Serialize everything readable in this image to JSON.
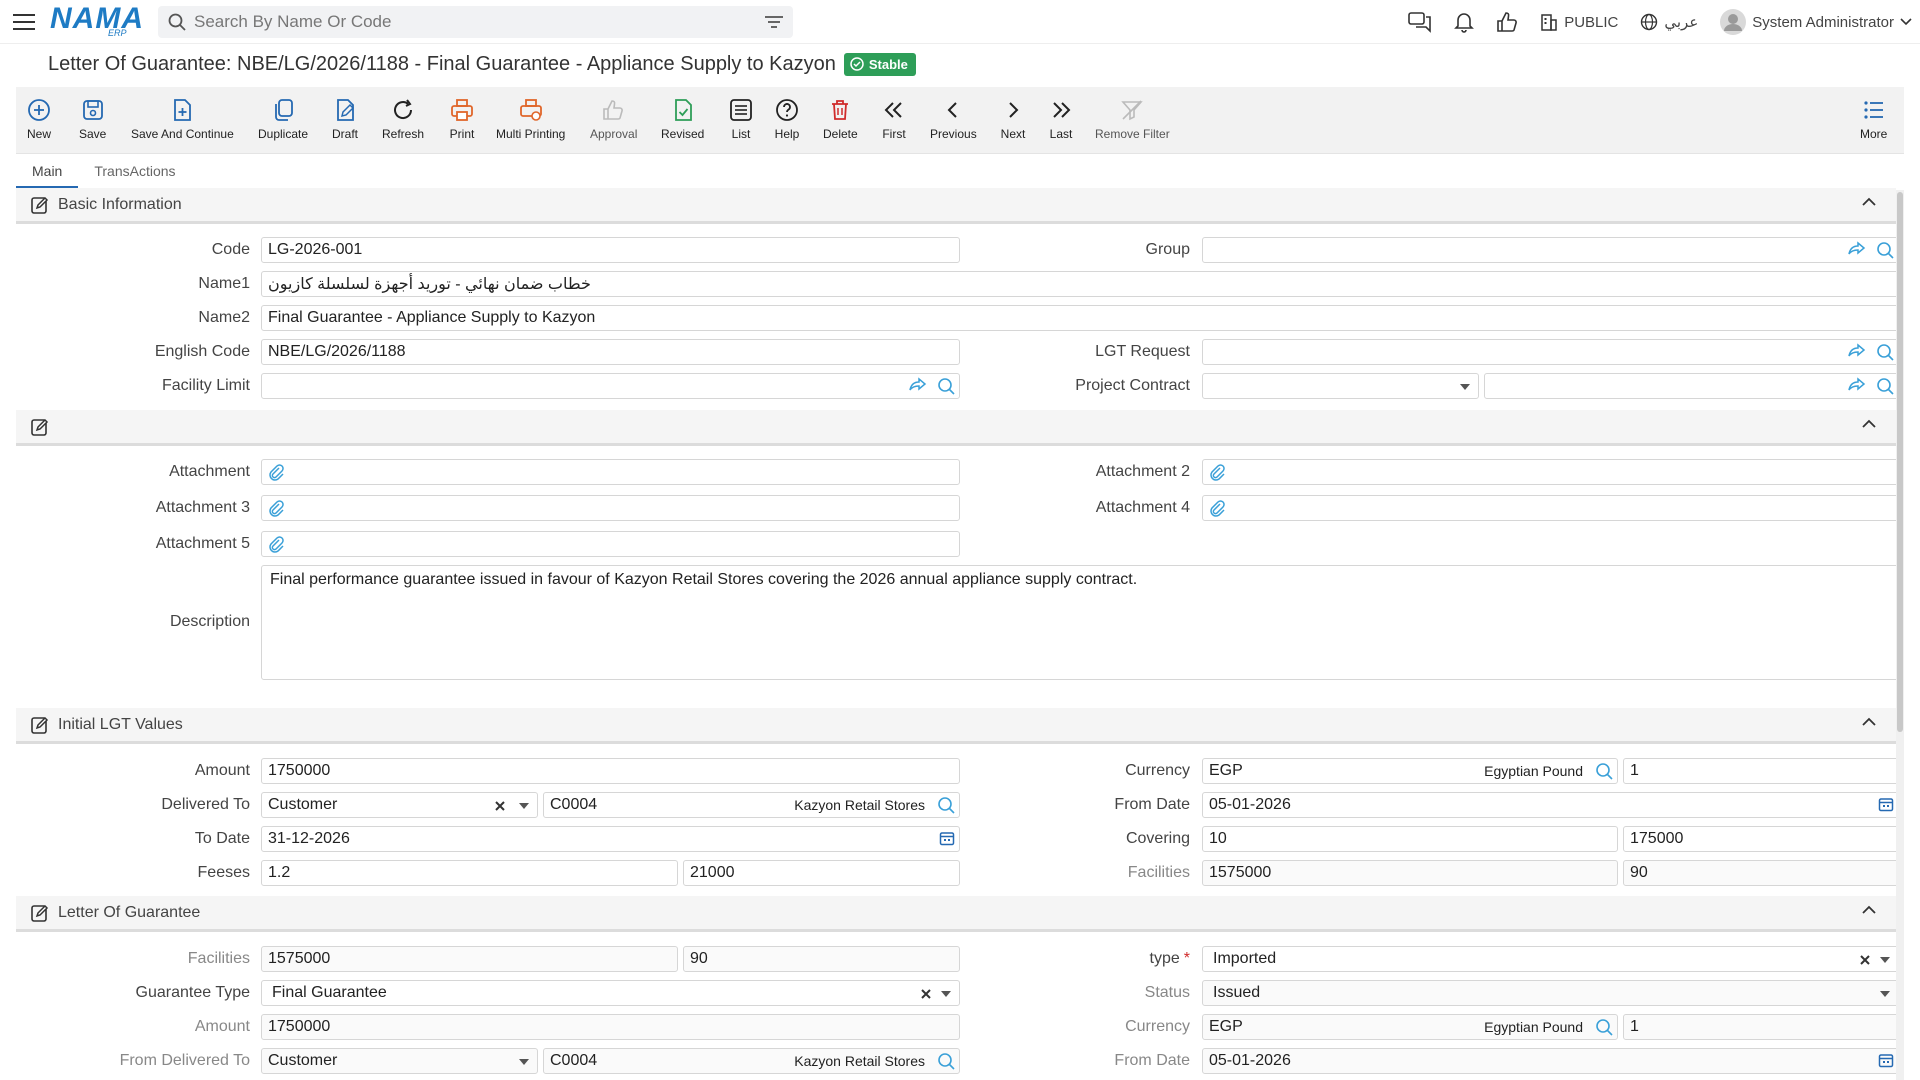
{
  "header": {
    "logo_text": "NAMA",
    "logo_sub": "ERP",
    "search_placeholder": "Search By Name Or Code",
    "branch": "PUBLIC",
    "language": "عربي",
    "user": "System Administrator"
  },
  "page": {
    "title": "Letter Of Guarantee: NBE/LG/2026/1188 - Final Guarantee - Appliance Supply to Kazyon",
    "status": "Stable"
  },
  "toolbar": {
    "new": "New",
    "save": "Save",
    "save_continue": "Save And Continue",
    "duplicate": "Duplicate",
    "draft": "Draft",
    "refresh": "Refresh",
    "print": "Print",
    "multi_printing": "Multi Printing",
    "approval": "Approval",
    "revised": "Revised",
    "list": "List",
    "help": "Help",
    "delete": "Delete",
    "first": "First",
    "previous": "Previous",
    "next": "Next",
    "last": "Last",
    "remove_filter": "Remove Filter",
    "more": "More"
  },
  "tabs": {
    "main": "Main",
    "transactions": "TransActions"
  },
  "basic": {
    "title": "Basic Information",
    "code_label": "Code",
    "code": "LG-2026-001",
    "group_label": "Group",
    "group": "",
    "name1_label": "Name1",
    "name1": "خطاب ضمان نهائي - توريد أجهزة لسلسلة كازيون",
    "name2_label": "Name2",
    "name2": "Final Guarantee - Appliance Supply to Kazyon",
    "english_code_label": "English Code",
    "english_code": "NBE/LG/2026/1188",
    "lgt_request_label": "LGT Request",
    "lgt_request": "",
    "facility_limit_label": "Facility Limit",
    "facility_limit": "",
    "project_contract_label": "Project Contract",
    "project_contract": ""
  },
  "attachments": {
    "a1_label": "Attachment",
    "a2_label": "Attachment 2",
    "a3_label": "Attachment 3",
    "a4_label": "Attachment 4",
    "a5_label": "Attachment 5",
    "description_label": "Description",
    "description": "Final performance guarantee issued in favour of Kazyon Retail Stores covering the 2026 annual appliance supply contract."
  },
  "initial": {
    "title": "Initial LGT Values",
    "amount_label": "Amount",
    "amount": "1750000",
    "currency_label": "Currency",
    "currency": "EGP",
    "currency_name": "Egyptian Pound",
    "rate": "1",
    "delivered_to_label": "Delivered To",
    "delivered_to": "Customer",
    "customer_code": "C0004",
    "customer_name": "Kazyon Retail Stores",
    "from_date_label": "From Date",
    "from_date": "05-01-2026",
    "to_date_label": "To Date",
    "to_date": "31-12-2026",
    "covering_label": "Covering",
    "covering_pct": "10",
    "covering_value": "175000",
    "feeses_label": "Feeses",
    "feeses_pct": "1.2",
    "feeses_value": "21000",
    "facilities_label": "Facilities",
    "facilities_value": "1575000",
    "facilities_pct": "90"
  },
  "lg": {
    "title": "Letter Of Guarantee",
    "facilities_label": "Facilities",
    "facilities_value": "1575000",
    "facilities_pct": "90",
    "type_label": "type",
    "type": "Imported",
    "guarantee_type_label": "Guarantee Type",
    "guarantee_type": "Final Guarantee",
    "status_label": "Status",
    "status": "Issued",
    "amount_label": "Amount",
    "amount": "1750000",
    "currency_label": "Currency",
    "currency": "EGP",
    "currency_name": "Egyptian Pound",
    "rate": "1",
    "from_delivered_to_label": "From Delivered To",
    "from_delivered_to": "Customer",
    "customer_code": "C0004",
    "customer_name": "Kazyon Retail Stores",
    "from_date_label": "From Date",
    "from_date": "05-01-2026"
  },
  "colors": {
    "accent": "#2569b2",
    "logo": "#1e7bc4",
    "stable": "#2e9e58",
    "print": "#e0662a",
    "revised": "#2e9e58",
    "delete": "#d02b2b",
    "link": "#3aa0d8"
  }
}
